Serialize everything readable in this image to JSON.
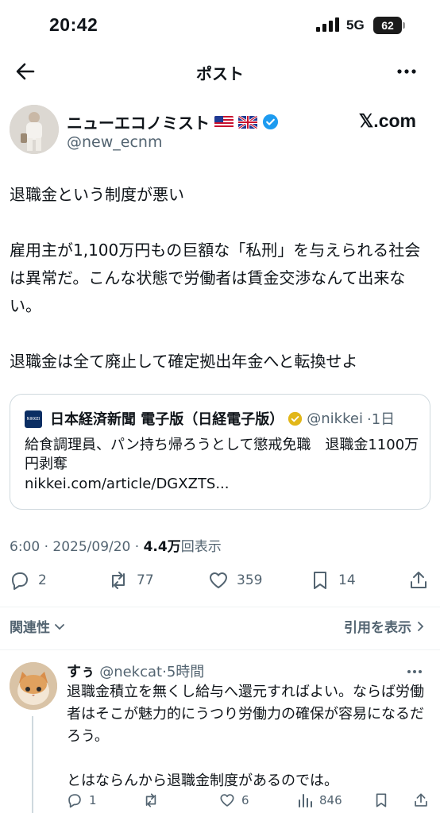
{
  "status_bar": {
    "time": "20:42",
    "network": "5G",
    "battery": "62"
  },
  "header": {
    "title": "ポスト"
  },
  "post": {
    "author_name": "ニューエコノミスト",
    "author_handle": "@new_ecnm",
    "site": "𝕏.com",
    "text": "退職金という制度が悪い\n\n雇用主が1,100万円もの巨額な「私刑」を与えられる社会は異常だ。こんな状態で労働者は賃金交渉なんて出来ない。\n\n退職金は全て廃止して確定拠出年金へと転換せよ",
    "quote": {
      "logo_text": "NIKKEI",
      "name": "日本経済新聞 電子版（日経電子版）",
      "handle": "@nikkei",
      "time": "·1日",
      "text": "給食調理員、パン持ち帰ろうとして懲戒免職　退職金1100万円剥奪",
      "link": "nikkei.com/article/DGXZTS..."
    },
    "timestamp": "6:00 · 2025/09/20 · ",
    "views_count": "4.4万",
    "views_label": "回表示",
    "actions": {
      "replies": "2",
      "reposts": "77",
      "likes": "359",
      "bookmarks": "14"
    }
  },
  "related": {
    "label": "関連性",
    "quotes_label": "引用を表示"
  },
  "reply": {
    "name": "すぅ",
    "handle": "@nekcat",
    "time": "·5時間",
    "text": "退職金積立を無くし給与へ還元すればよい。ならば労働者はそこが魅力的にうつり労働力の確保が容易になるだろう。\n\nとはならんから退職金制度があるのでは。",
    "actions": {
      "replies": "1",
      "likes": "6",
      "views": "846"
    }
  }
}
